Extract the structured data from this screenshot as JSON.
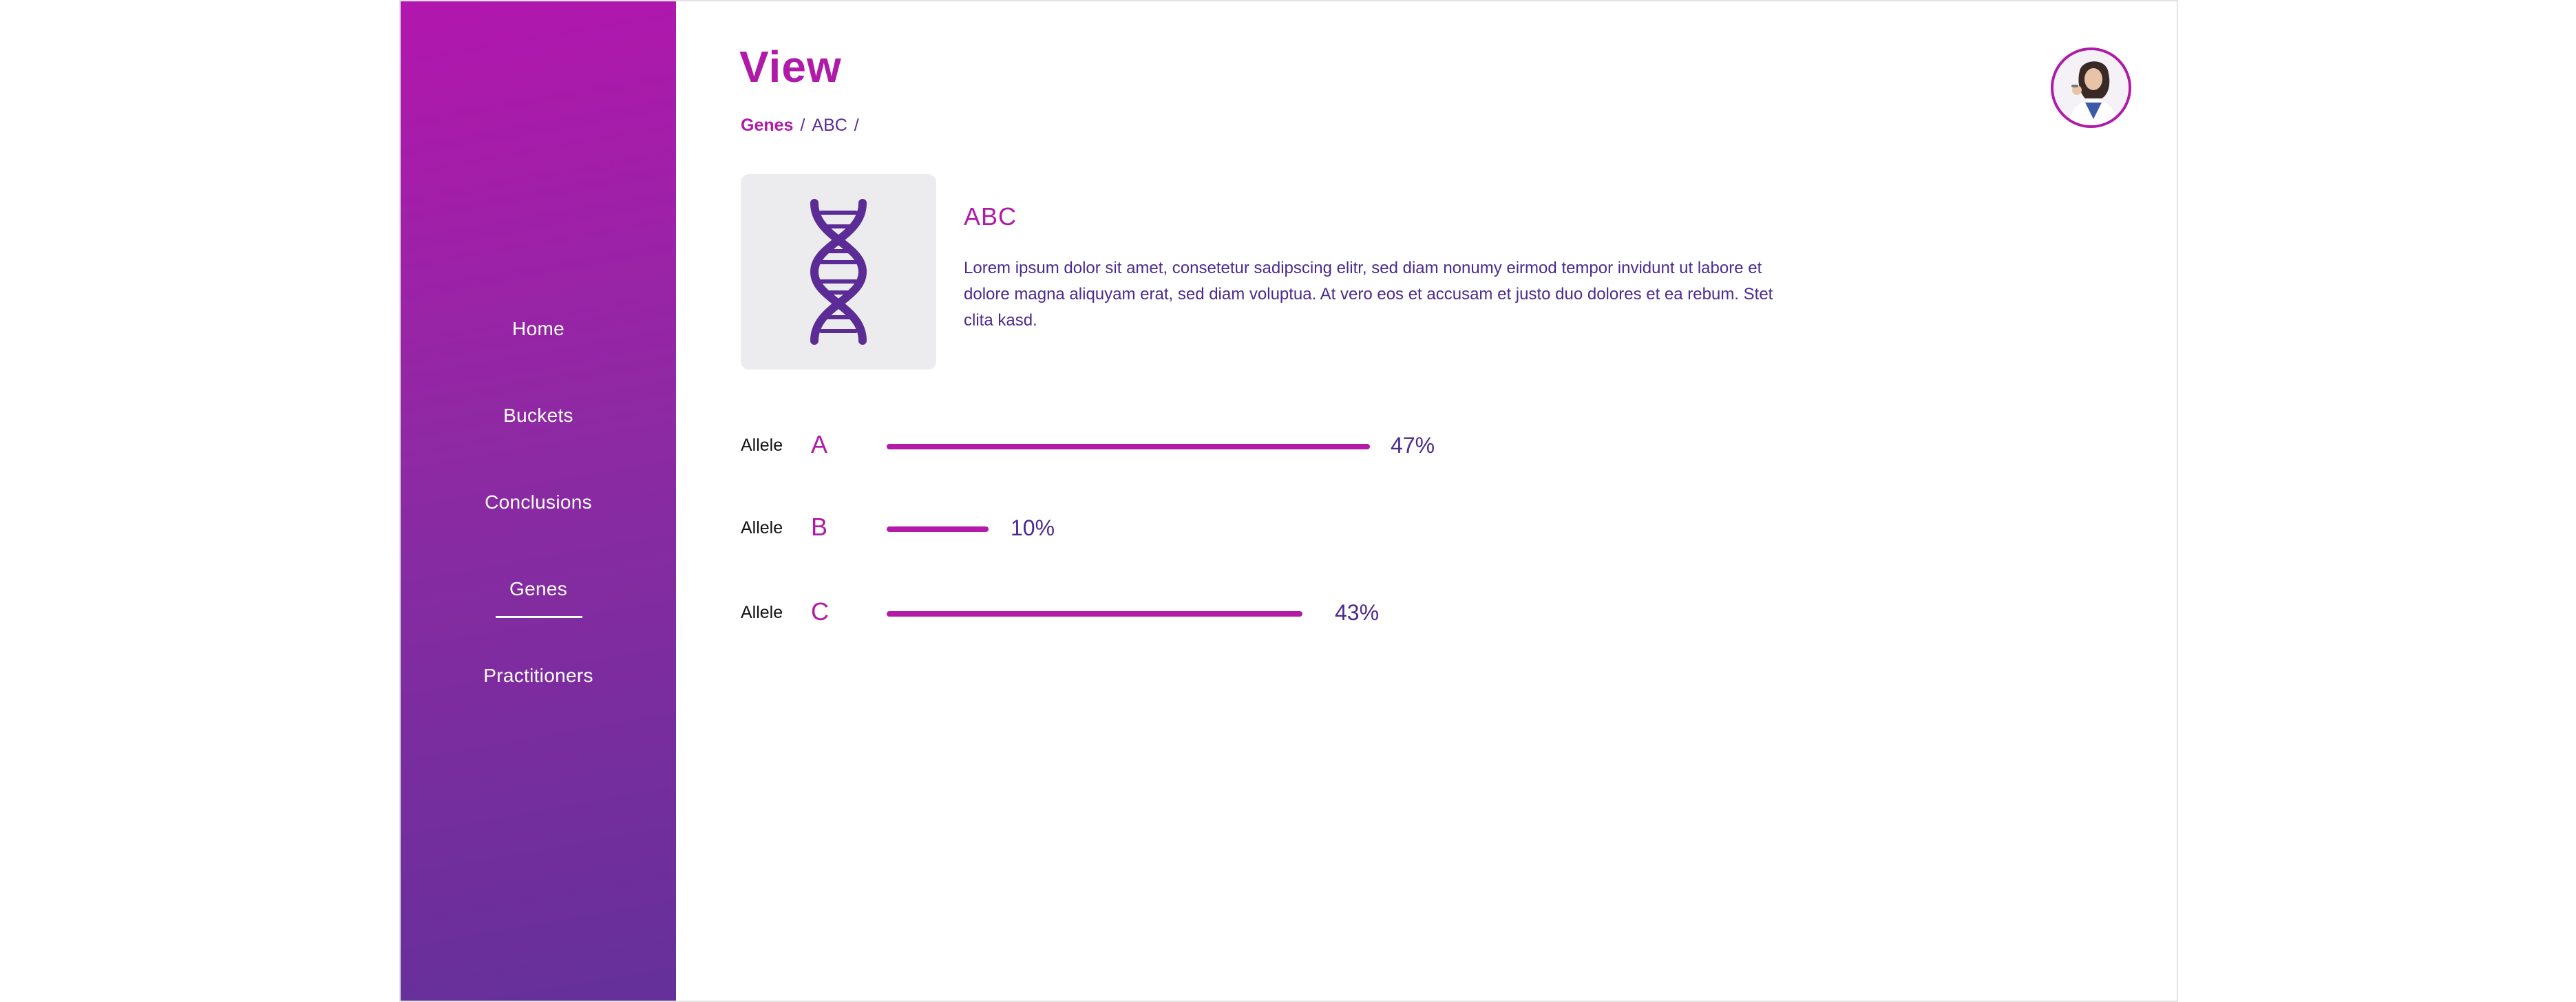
{
  "sidebar": {
    "items": [
      {
        "label": "Home"
      },
      {
        "label": "Buckets"
      },
      {
        "label": "Conclusions"
      },
      {
        "label": "Genes",
        "active": true
      },
      {
        "label": "Practitioners"
      }
    ]
  },
  "header": {
    "title": "View",
    "breadcrumb": [
      "Genes",
      "ABC"
    ],
    "separator": "/"
  },
  "avatar": {
    "icon": "user-avatar"
  },
  "gene": {
    "icon": "dna-icon",
    "name": "ABC",
    "description": "Lorem ipsum dolor sit amet, consetetur sadipscing elitr, sed diam nonumy eirmod tempor invidunt ut labore et dolore magna aliquyam erat, sed diam voluptua. At vero eos et accusam et justo duo dolores et ea rebum. Stet clita kasd."
  },
  "alleles": [
    {
      "label": "Allele",
      "letter": "A",
      "value": 47,
      "display": "47%"
    },
    {
      "label": "Allele",
      "letter": "B",
      "value": 10,
      "display": "10%"
    },
    {
      "label": "Allele",
      "letter": "C",
      "value": 43,
      "display": "43%"
    }
  ],
  "colors": {
    "accent": "#b01aa8",
    "text_primary": "#4b2a8f",
    "sidebar_gradient_top": "#b216ad",
    "sidebar_gradient_bottom": "#64309a",
    "card_bg": "#ececee"
  }
}
